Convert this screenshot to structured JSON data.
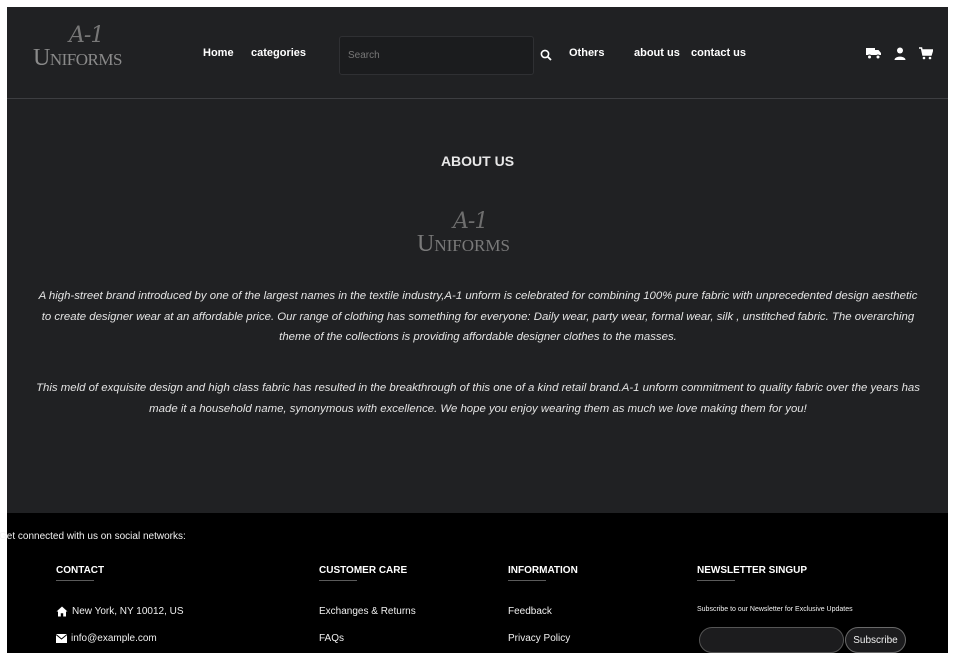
{
  "header": {
    "logo_script": "A-1",
    "logo_word": "Uniforms",
    "nav": [
      {
        "label": "Home"
      },
      {
        "label": "categories"
      },
      {
        "label": "Others"
      },
      {
        "label": "about us"
      },
      {
        "label": "contact us"
      }
    ],
    "search": {
      "placeholder": "Search",
      "value": ""
    },
    "icons": [
      "search-icon",
      "truck-icon",
      "user-icon",
      "cart-icon"
    ]
  },
  "main": {
    "title": "ABOUT US",
    "logo_script": "A-1",
    "logo_word": "Uniforms",
    "paragraphs": [
      "A high-street brand introduced by one of the largest names in the textile industry,A-1 unform is celebrated for combining 100% pure fabric with unprecedented design aesthetic to create designer wear at an affordable price. Our range of clothing has something for everyone: Daily wear, party wear, formal wear, silk , unstitched fabric. The overarching theme of the collections is providing affordable designer clothes to the masses.",
      "This meld of exquisite design and high class fabric has resulted in the breakthrough of this one of a kind retail brand.A-1 unform commitment to quality fabric over the years has made it a household name, synonymous with excellence. We hope you enjoy wearing them as much we love making them for you!"
    ]
  },
  "footer": {
    "social_text": "Get connected with us on social networks:",
    "contact": {
      "title": "CONTACT",
      "address": "New York, NY 10012, US",
      "email": "info@example.com"
    },
    "customer_care": {
      "title": "CUSTOMER CARE",
      "items": [
        "Exchanges & Returns",
        "FAQs"
      ]
    },
    "information": {
      "title": "INFORMATION",
      "items": [
        "Feedback",
        "Privacy Policy"
      ]
    },
    "newsletter": {
      "title": "NEWSLETTER SINGUP",
      "text": "Subscribe to our Newsletter for Exclusive Updates",
      "input_value": "",
      "button_label": "Subscribe"
    }
  },
  "colors": {
    "page_bg": "#202123",
    "footer_bg": "#000000",
    "text": "#ffffff"
  }
}
